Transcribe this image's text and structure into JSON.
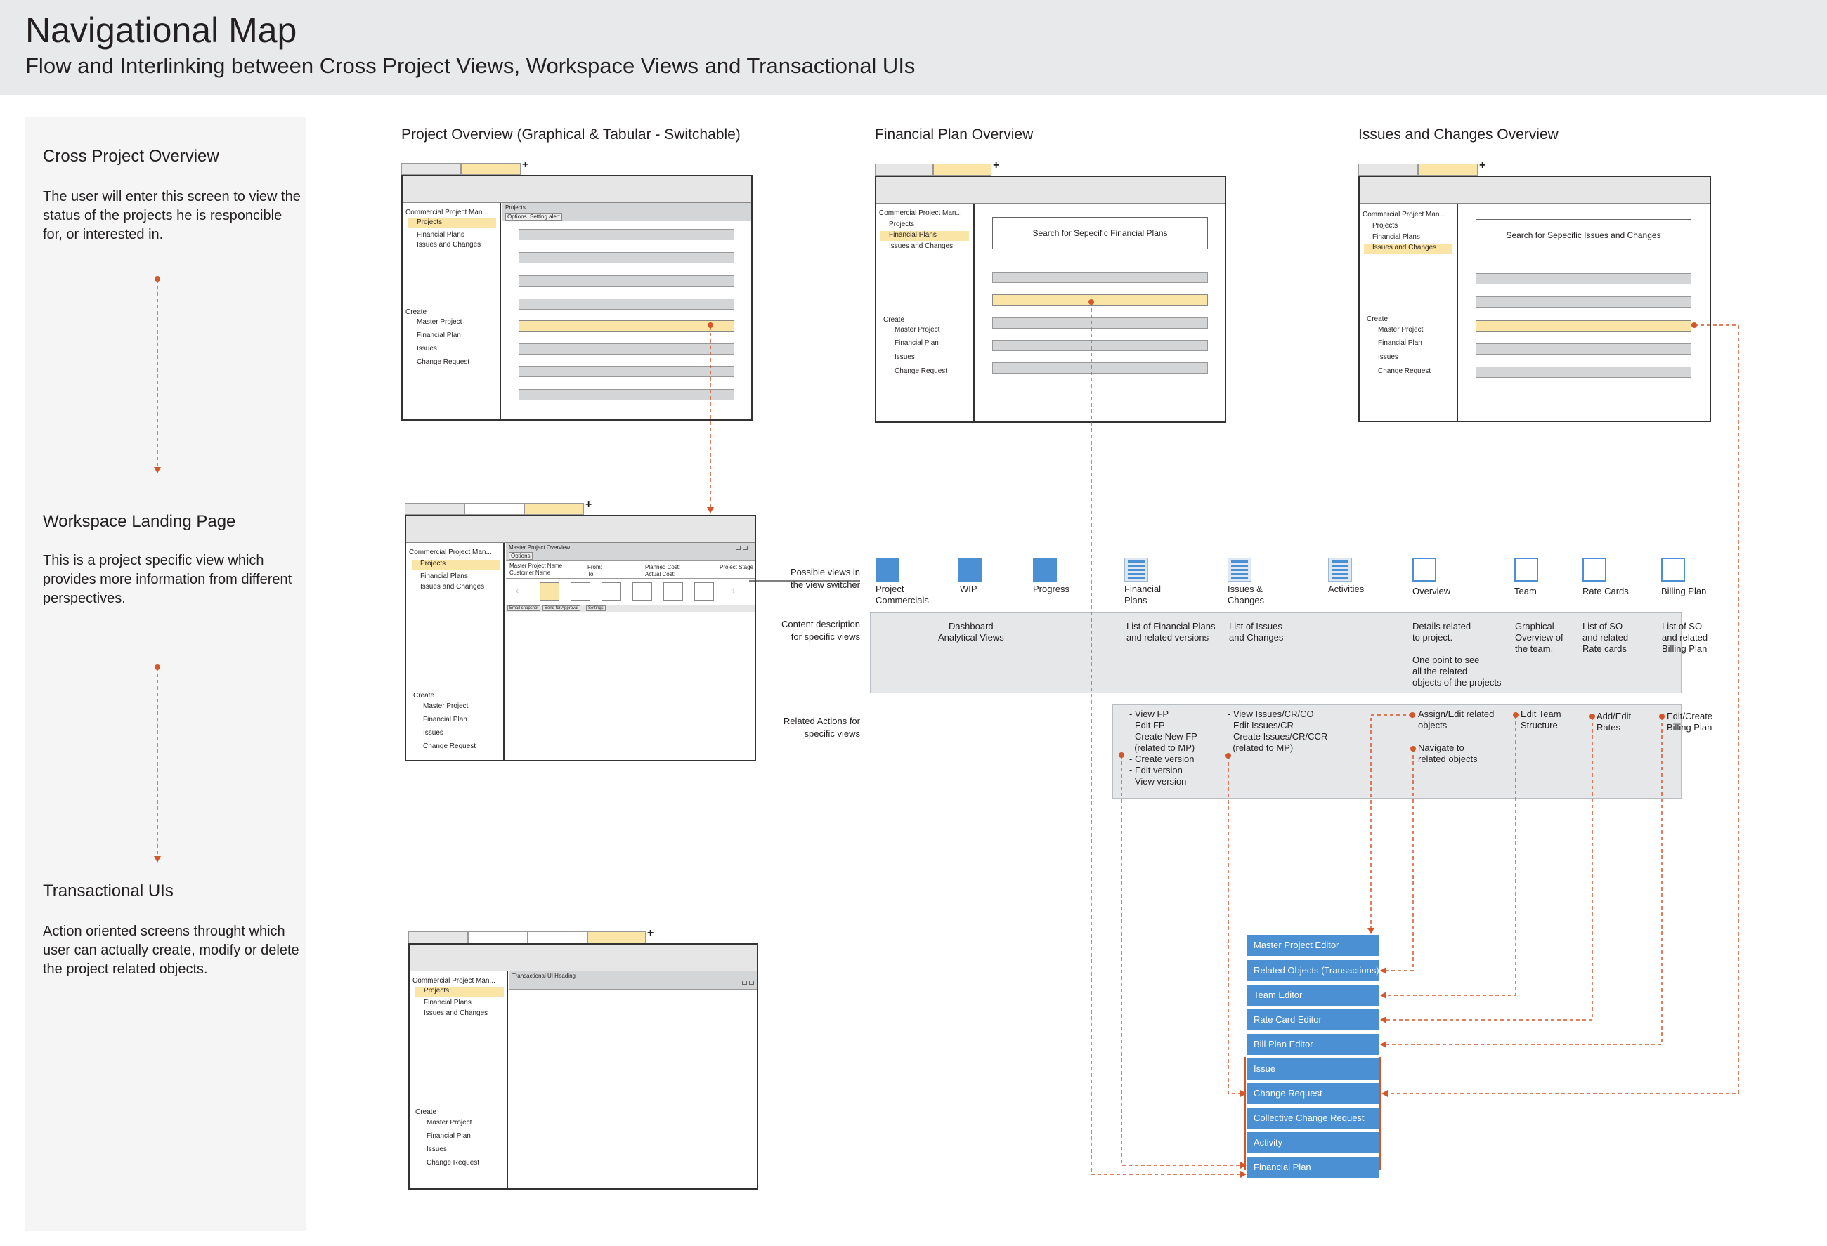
{
  "header": {
    "title": "Navigational Map",
    "subtitle": "Flow and Interlinking between Cross Project Views, Workspace Views and Transactional UIs"
  },
  "left": {
    "s1": {
      "title": "Cross Project Overview",
      "desc": "The user will enter this screen to view the status of the projects he is responcible for, or interested in."
    },
    "s2": {
      "title": "Workspace Landing Page",
      "desc": "This is a project specific view which provides more information from different perspectives."
    },
    "s3": {
      "title": "Transactional UIs",
      "desc": "Action oriented screens throught which user can actually create, modify or delete the project related objects."
    }
  },
  "columns": {
    "c1": "Project Overview (Graphical & Tabular - Switchable)",
    "c2": "Financial Plan Overview",
    "c3": "Issues and Changes Overview"
  },
  "nav": {
    "app": "Commercial Project Man...",
    "projects": "Projects",
    "financial_plans": "Financial Plans",
    "issues_changes": "Issues and Changes",
    "create": "Create",
    "master_project": "Master Project",
    "financial_plan": "Financial Plan",
    "issues": "Issues",
    "change_request": "Change Request"
  },
  "wf1": {
    "panel": "Projects",
    "btn1": "Options",
    "btn2": "Setting alert"
  },
  "wf2": {
    "search": "Search for Sepecific Financial Plans"
  },
  "wf3": {
    "search": "Search for Sepecific Issues and Changes"
  },
  "wf4": {
    "title": "Master Project Overview",
    "opt": "Options",
    "f1": "Master Project Name",
    "f2": "Customer Name",
    "f3": "From:",
    "f4": "To:",
    "f5": "Planned Cost:",
    "f6": "Actual Cost:",
    "f7": "Project Stage",
    "b1": "Email snapshot",
    "b2": "Send for Approval",
    "b3": "Settings"
  },
  "wf5": {
    "title": "Transactional UI Heading"
  },
  "rows": {
    "views": "Possible views in\nthe view switcher",
    "content": "Content description\nfor specific views",
    "actions": "Related Actions for\nspecific views"
  },
  "views": [
    {
      "icon": "blue-square-icon",
      "label": "Project\nCommercials"
    },
    {
      "icon": "blue-square-icon",
      "label": "WIP"
    },
    {
      "icon": "blue-square-icon",
      "label": "Progress"
    },
    {
      "icon": "list-icon",
      "label": "Financial\nPlans"
    },
    {
      "icon": "list-icon",
      "label": "Issues &\nChanges"
    },
    {
      "icon": "list-icon",
      "label": "Activities"
    },
    {
      "icon": "outline-square-icon",
      "label": "Overview"
    },
    {
      "icon": "outline-square-icon",
      "label": "Team"
    },
    {
      "icon": "outline-square-icon",
      "label": "Rate Cards"
    },
    {
      "icon": "outline-square-icon",
      "label": "Billing Plan"
    }
  ],
  "content": {
    "c1": "Dashboard\nAnalytical Views",
    "c2": "List of Financial Plans\nand related versions",
    "c3": "List of Issues\nand Changes",
    "c4": "Details related\nto project.\n\nOne point to see\nall the related\nobjects of the projects",
    "c5": "Graphical\nOverview of\nthe team.",
    "c6": "List of SO\nand related\nRate cards",
    "c7": "List of SO\nand related\nBilling Plan"
  },
  "actions": {
    "a1": "- View FP\n- Edit FP\n- Create New FP\n  (related to MP)\n- Create version\n- Edit version\n- View version",
    "a2": "- View Issues/CR/CO\n- Edit Issues/CR\n- Create Issues/CR/CCR\n  (related to MP)",
    "a3": "Assign/Edit related\nobjects",
    "a3b": "Navigate to\nrelated objects",
    "a4": "Edit Team\nStructure",
    "a5": "Add/Edit\nRates",
    "a6": "Edit/Create\nBilling Plan"
  },
  "editors": [
    "Master Project Editor",
    "Related Objects (Transactions)",
    "Team Editor",
    "Rate Card Editor",
    "Bill Plan Editor",
    "Issue",
    "Change Request",
    "Collective Change Request",
    "Activity",
    "Financial Plan"
  ],
  "colors": {
    "accent": "#4a90d2",
    "highlight": "#fbe5a6",
    "connector": "#d4572a",
    "panel": "#e6e7e8"
  }
}
